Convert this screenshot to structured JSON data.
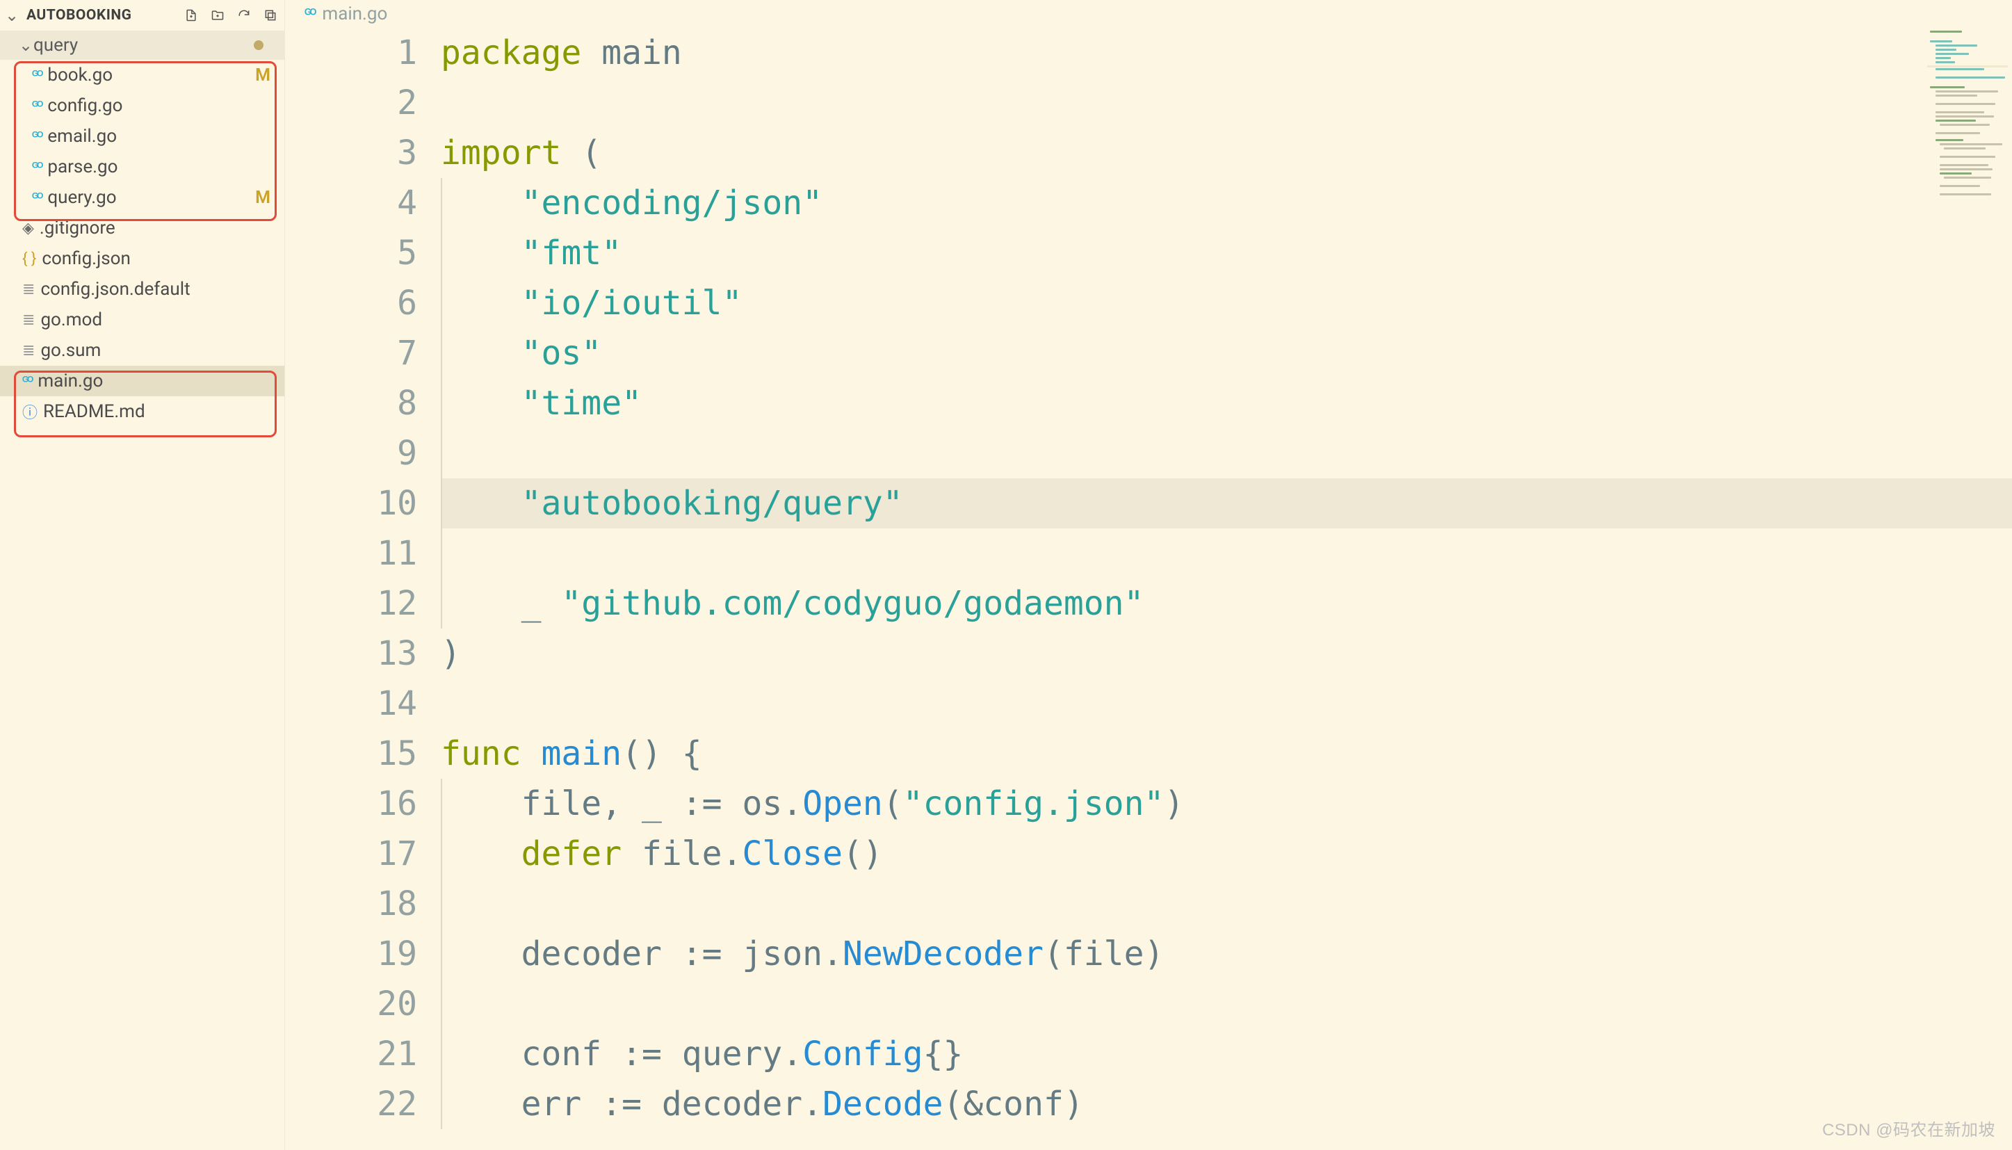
{
  "explorer": {
    "root_label": "AUTOBOOKING",
    "actions": [
      "new-file",
      "new-folder",
      "refresh",
      "collapse-all"
    ],
    "folder": {
      "name": "query",
      "modified": true
    },
    "folder_files": [
      {
        "name": "book.go",
        "icon": "go",
        "status": "M"
      },
      {
        "name": "config.go",
        "icon": "go",
        "status": ""
      },
      {
        "name": "email.go",
        "icon": "go",
        "status": ""
      },
      {
        "name": "parse.go",
        "icon": "go",
        "status": ""
      },
      {
        "name": "query.go",
        "icon": "go",
        "status": "M"
      }
    ],
    "root_files": [
      {
        "name": ".gitignore",
        "icon": "diamond"
      },
      {
        "name": "config.json",
        "icon": "braces"
      },
      {
        "name": "config.json.default",
        "icon": "lines"
      },
      {
        "name": "go.mod",
        "icon": "lines"
      },
      {
        "name": "go.sum",
        "icon": "lines"
      },
      {
        "name": "main.go",
        "icon": "go",
        "selected": true
      },
      {
        "name": "README.md",
        "icon": "info"
      }
    ]
  },
  "tab": {
    "filename": "main.go"
  },
  "code": {
    "highlight_line": 10,
    "lines": [
      {
        "n": 1,
        "ind": 0,
        "tokens": [
          [
            "kw",
            "package "
          ],
          [
            "ident",
            "main"
          ]
        ]
      },
      {
        "n": 2,
        "ind": 0,
        "tokens": []
      },
      {
        "n": 3,
        "ind": 0,
        "tokens": [
          [
            "kw",
            "import "
          ],
          [
            "punc",
            "("
          ]
        ]
      },
      {
        "n": 4,
        "ind": 1,
        "tokens": [
          [
            "str",
            "\"encoding/json\""
          ]
        ]
      },
      {
        "n": 5,
        "ind": 1,
        "tokens": [
          [
            "str",
            "\"fmt\""
          ]
        ]
      },
      {
        "n": 6,
        "ind": 1,
        "tokens": [
          [
            "str",
            "\"io/ioutil\""
          ]
        ]
      },
      {
        "n": 7,
        "ind": 1,
        "tokens": [
          [
            "str",
            "\"os\""
          ]
        ]
      },
      {
        "n": 8,
        "ind": 1,
        "tokens": [
          [
            "str",
            "\"time\""
          ]
        ]
      },
      {
        "n": 9,
        "ind": 1,
        "tokens": []
      },
      {
        "n": 10,
        "ind": 1,
        "tokens": [
          [
            "str",
            "\"autobooking/query\""
          ]
        ]
      },
      {
        "n": 11,
        "ind": 1,
        "tokens": []
      },
      {
        "n": 12,
        "ind": 1,
        "tokens": [
          [
            "ident",
            "_ "
          ],
          [
            "str",
            "\"github.com/codyguo/godaemon\""
          ]
        ]
      },
      {
        "n": 13,
        "ind": 0,
        "tokens": [
          [
            "punc",
            ")"
          ]
        ]
      },
      {
        "n": 14,
        "ind": 0,
        "tokens": []
      },
      {
        "n": 15,
        "ind": 0,
        "tokens": [
          [
            "kw",
            "func "
          ],
          [
            "fn",
            "main"
          ],
          [
            "punc",
            "() {"
          ]
        ]
      },
      {
        "n": 16,
        "ind": 1,
        "tokens": [
          [
            "ident",
            "file, _ "
          ],
          [
            "punc",
            ":= "
          ],
          [
            "ident",
            "os."
          ],
          [
            "fn",
            "Open"
          ],
          [
            "punc",
            "("
          ],
          [
            "str",
            "\"config.json\""
          ],
          [
            "punc",
            ")"
          ]
        ]
      },
      {
        "n": 17,
        "ind": 1,
        "tokens": [
          [
            "kw",
            "defer "
          ],
          [
            "ident",
            "file."
          ],
          [
            "fn",
            "Close"
          ],
          [
            "punc",
            "()"
          ]
        ]
      },
      {
        "n": 18,
        "ind": 1,
        "tokens": []
      },
      {
        "n": 19,
        "ind": 1,
        "tokens": [
          [
            "ident",
            "decoder "
          ],
          [
            "punc",
            ":= "
          ],
          [
            "ident",
            "json."
          ],
          [
            "fn",
            "NewDecoder"
          ],
          [
            "punc",
            "(file)"
          ]
        ]
      },
      {
        "n": 20,
        "ind": 1,
        "tokens": []
      },
      {
        "n": 21,
        "ind": 1,
        "tokens": [
          [
            "ident",
            "conf "
          ],
          [
            "punc",
            ":= "
          ],
          [
            "ident",
            "query."
          ],
          [
            "fn",
            "Config"
          ],
          [
            "punc",
            "{}"
          ]
        ]
      },
      {
        "n": 22,
        "ind": 1,
        "tokens": [
          [
            "ident",
            "err "
          ],
          [
            "punc",
            ":= "
          ],
          [
            "ident",
            "decoder."
          ],
          [
            "fn",
            "Decode"
          ],
          [
            "punc",
            "(&conf)"
          ]
        ]
      }
    ]
  },
  "watermark": "CSDN @码农在新加坡"
}
